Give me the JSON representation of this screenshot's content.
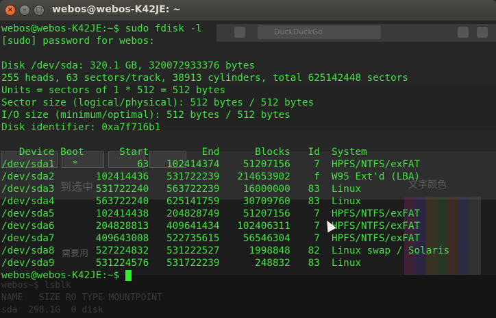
{
  "window": {
    "title": "webos@webos-K42JE: ~",
    "buttons": {
      "close": "×",
      "minimize": "–",
      "maximize": "□"
    }
  },
  "background": {
    "search_placeholder": "DuckDuckGo",
    "chinese_1": "到选中",
    "chinese_2": "需要用",
    "chinese_3": "文字颜色",
    "lower_1": "webos~$ lsblk",
    "lower_2": "NAME   SIZE RO TYPE MOUNTPOINT",
    "lower_3": "sda  298.1G  0 disk"
  },
  "terminal": {
    "lines": [
      "webos@webos-K42JE:~$ sudo fdisk -l",
      "[sudo] password for webos:",
      "",
      "Disk /dev/sda: 320.1 GB, 320072933376 bytes",
      "255 heads, 63 sectors/track, 38913 cylinders, total 625142448 sectors",
      "Units = sectors of 1 * 512 = 512 bytes",
      "Sector size (logical/physical): 512 bytes / 512 bytes",
      "I/O size (minimum/optimal): 512 bytes / 512 bytes",
      "Disk identifier: 0xa7f716b1",
      "",
      "   Device Boot      Start         End      Blocks   Id  System",
      "/dev/sda1   *          63   102414374    51207156    7  HPFS/NTFS/exFAT",
      "/dev/sda2       102414436   531722239   214653902    f  W95 Ext'd (LBA)",
      "/dev/sda3       531722240   563722239    16000000   83  Linux",
      "/dev/sda4       563722240   625141759    30709760   83  Linux",
      "/dev/sda5       102414438   204828749    51207156    7  HPFS/NTFS/exFAT",
      "/dev/sda6       204828813   409641434   102406311    7  HPFS/NTFS/exFAT",
      "/dev/sda7       409643008   522735615    56546304    7  HPFS/NTFS/exFAT",
      "/dev/sda8       527224832   531222527     1998848   82  Linux swap / Solaris",
      "/dev/sda9       531224576   531722239      248832   83  Linux"
    ],
    "prompt": "webos@webos-K42JE:~$ "
  },
  "colors": {
    "terminal_text": "#44e044",
    "cursor": "#2af22a",
    "titlebar": "#3c3b37",
    "close_button": "#d8501a"
  }
}
